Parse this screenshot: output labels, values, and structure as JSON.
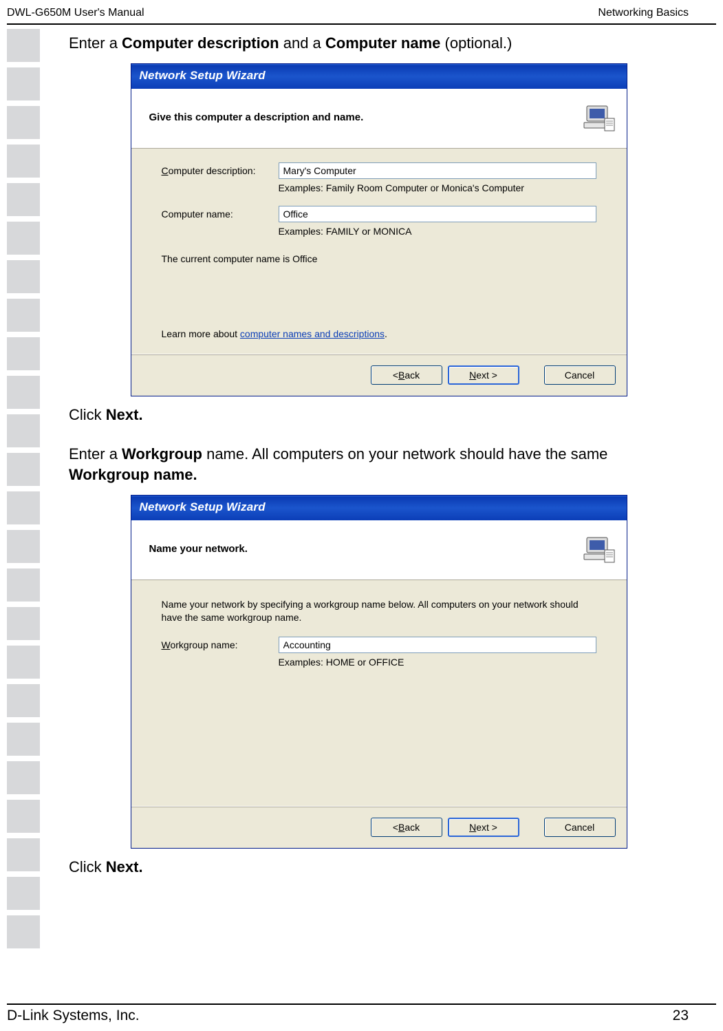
{
  "header": {
    "left": "DWL-G650M User's Manual",
    "right": "Networking Basics"
  },
  "section1": {
    "intro_pre": "Enter a ",
    "intro_bold1": "Computer description",
    "intro_mid": " and a ",
    "intro_bold2": "Computer name",
    "intro_post": " (optional.)",
    "click": "Click ",
    "next_bold": "Next."
  },
  "wizard1": {
    "title": "Network Setup Wizard",
    "header": "Give this computer a description and name.",
    "desc_label_pre": "C",
    "desc_label_post": "omputer description:",
    "desc_value": "Mary's Computer",
    "desc_examples": "Examples: Family Room Computer or Monica's Computer",
    "name_label": "Computer name:",
    "name_value": "Office",
    "name_examples": "Examples: FAMILY or MONICA",
    "current": "The current computer name is Office",
    "learn_pre": "Learn more about ",
    "learn_link": "computer names and descriptions",
    "learn_post": ".",
    "back": "< Back",
    "next": "Next >",
    "back_u": "B",
    "next_u": "N",
    "cancel": "Cancel"
  },
  "section2": {
    "intro_pre": "Enter a ",
    "intro_bold1": "Workgroup",
    "intro_mid": " name.  All computers on your network should have the same ",
    "intro_bold2": "Workgroup name.",
    "click": "Click ",
    "next_bold": "Next."
  },
  "wizard2": {
    "title": "Network Setup Wizard",
    "header": "Name your network.",
    "desc": "Name your network by specifying a workgroup name below. All computers on your network should have the same workgroup name.",
    "wg_label_pre": "W",
    "wg_label_post": "orkgroup name:",
    "wg_value": "Accounting",
    "wg_examples": "Examples: HOME or OFFICE",
    "back": "< Back",
    "next": "Next >",
    "back_u": "B",
    "next_u": "N",
    "cancel": "Cancel"
  },
  "footer": {
    "left": "D-Link Systems, Inc.",
    "right": "23"
  }
}
